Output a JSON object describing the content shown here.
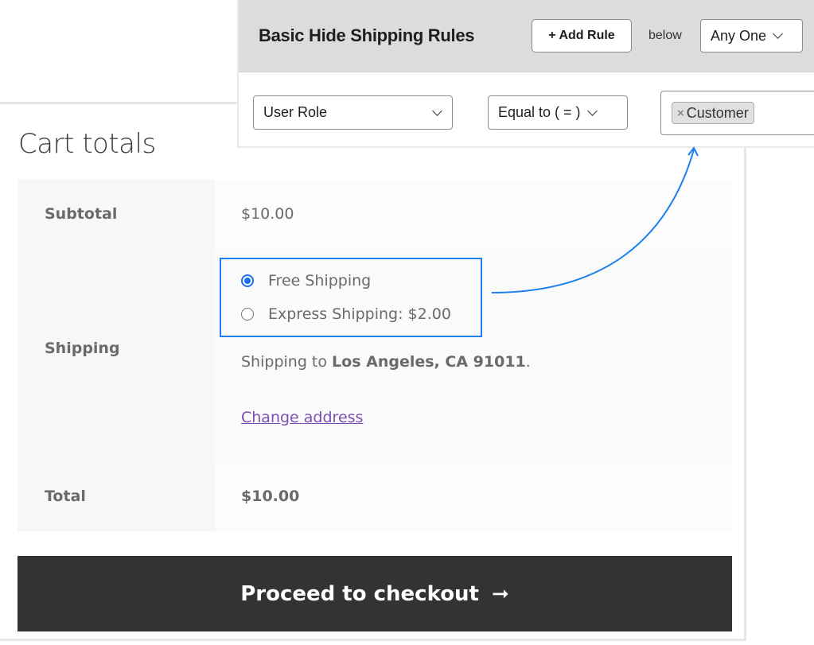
{
  "rules_panel": {
    "title": "Basic Hide Shipping Rules",
    "add_rule_label": "+ Add Rule",
    "below_label": "below",
    "match_select_value": "Any One",
    "condition": {
      "field_value": "User Role",
      "operator_value": "Equal to ( = )",
      "tags": [
        {
          "label": "Customer",
          "remove_glyph": "×"
        }
      ]
    }
  },
  "cart": {
    "title": "Cart totals",
    "rows": {
      "subtotal": {
        "label": "Subtotal",
        "value": "$10.00"
      },
      "shipping": {
        "label": "Shipping",
        "options": [
          {
            "label": "Free Shipping",
            "selected": true
          },
          {
            "label": "Express Shipping: $2.00",
            "selected": false
          }
        ],
        "destination_prefix": "Shipping to ",
        "destination": "Los Angeles, CA 91011",
        "destination_suffix": ".",
        "change_address_label": "Change address"
      },
      "total": {
        "label": "Total",
        "value": "$10.00"
      }
    },
    "checkout_label": "Proceed to checkout",
    "checkout_arrow": "➞"
  },
  "colors": {
    "highlight": "#1a7ff0",
    "link": "#7c4fb5",
    "checkout_bg": "#333333"
  }
}
